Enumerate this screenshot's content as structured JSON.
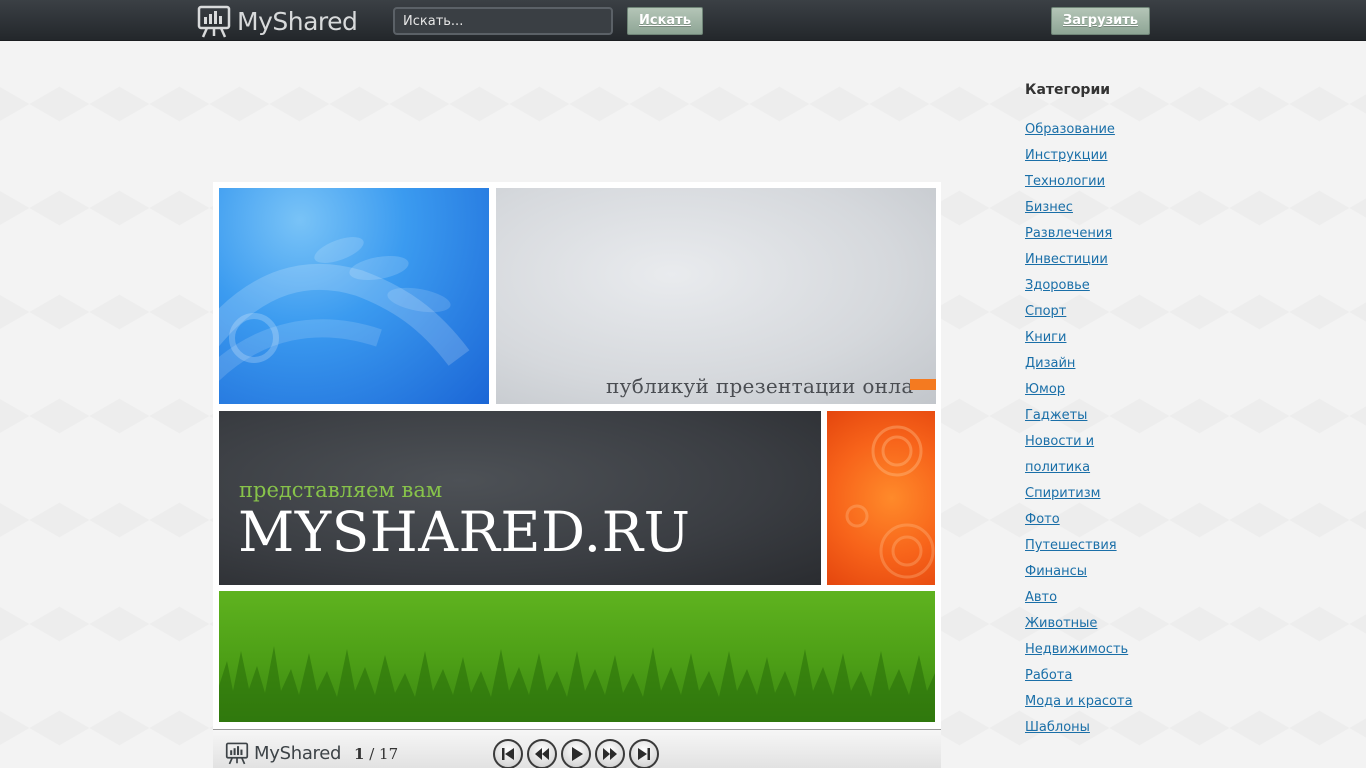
{
  "header": {
    "logo_text": "MyShared",
    "search_placeholder": "Искать...",
    "search_button": "Искать",
    "upload_button": "Загрузить"
  },
  "slide": {
    "tagline": "публикуй презентации онла",
    "subtitle": "представляем вам",
    "title": "MYSHARED.RU"
  },
  "player": {
    "logo_text": "MyShared",
    "current_page": "1",
    "total_pages": "/ 17",
    "controls": [
      "first-icon",
      "prev-icon",
      "play-icon",
      "next-icon",
      "last-icon"
    ]
  },
  "sidebar": {
    "title": "Категории",
    "categories": [
      "Образование",
      "Инструкции",
      "Технологии",
      "Бизнес",
      "Развлечения",
      "Инвестиции",
      "Здоровье",
      "Спорт",
      "Книги",
      "Дизайн",
      "Юмор",
      "Гаджеты",
      "Новости и",
      "политика",
      "Спиритизм",
      "Фото",
      "Путешествия",
      "Финансы",
      "Авто",
      "Животные",
      "Недвижимость",
      "Работа",
      "Мода и красота",
      "Шаблоны"
    ]
  },
  "colors": {
    "topbar": "#2e3236",
    "button": "#9fb4a4",
    "link": "#1a6fa8",
    "slide_green_text": "#87c34a"
  }
}
